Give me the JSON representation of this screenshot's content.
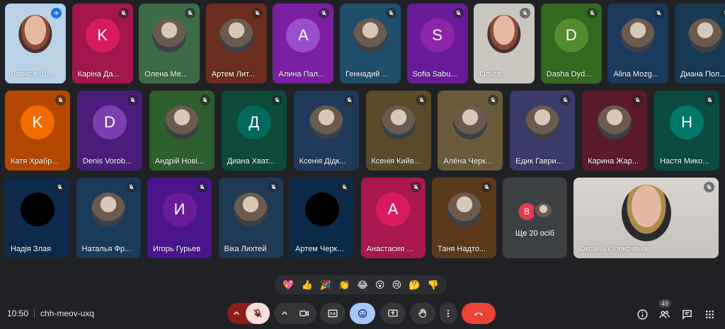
{
  "participants_row1": [
    {
      "name": "Лариса Ш...",
      "bg": "#b9d2e6",
      "speaking": true,
      "video": true,
      "mic": "active"
    },
    {
      "name": "Каріна Да...",
      "bg": "#a3164d",
      "initial": "K",
      "avatar": "#d81b60",
      "mic": "muted"
    },
    {
      "name": "Олена Ме...",
      "bg": "#3d6b45",
      "photo": true,
      "mic": "muted"
    },
    {
      "name": "Артем Лит...",
      "bg": "#6b2d1f",
      "photo": true,
      "mic": "muted"
    },
    {
      "name": "Алина Пал...",
      "bg": "#7b1fa2",
      "initial": "A",
      "avatar": "#9c4dcc",
      "mic": "muted"
    },
    {
      "name": "Геннадий ...",
      "bg": "#1f4e6b",
      "photo": true,
      "mic": "muted"
    },
    {
      "name": "Sofia Sabu...",
      "bg": "#6a1b9a",
      "initial": "S",
      "avatar": "#8e24aa",
      "mic": "muted"
    },
    {
      "name": "Ольга ...",
      "bg": "#c9c6c0",
      "video": true,
      "mic": "muted"
    },
    {
      "name": "Dasha Dyd...",
      "bg": "#33691e",
      "initial": "D",
      "avatar": "#558b2f",
      "mic": "muted"
    },
    {
      "name": "Alina Mozg...",
      "bg": "#1a3a5c",
      "photo": true,
      "mic": "muted"
    },
    {
      "name": "Диана Пол...",
      "bg": "#173a52",
      "photo": true,
      "mic": "muted"
    }
  ],
  "participants_row2": [
    {
      "name": "Катя Храбр...",
      "bg": "#b34700",
      "initial": "K",
      "avatar": "#ef6c00",
      "mic": "muted"
    },
    {
      "name": "Denis Vorob...",
      "bg": "#4a1d7a",
      "initial": "D",
      "avatar": "#7b3fb0",
      "mic": "muted"
    },
    {
      "name": "Андрій Нові...",
      "bg": "#2e5e2e",
      "photo": true,
      "mic": "muted"
    },
    {
      "name": "Диана Хват...",
      "bg": "#0d4a3a",
      "initial": "Д",
      "avatar": "#00695c",
      "mic": "muted"
    },
    {
      "name": "Ксенія Дідк...",
      "bg": "#1f3a5a",
      "photo": true,
      "mic": "muted"
    },
    {
      "name": "Ксенія Кийв...",
      "bg": "#5a4a2a",
      "photo": true,
      "mic": "muted"
    },
    {
      "name": "Алёна Черк...",
      "bg": "#6b5a3a",
      "photo": true,
      "mic": "muted"
    },
    {
      "name": "Едик Гаври...",
      "bg": "#3a3a6b",
      "photo": true,
      "mic": "muted"
    },
    {
      "name": "Карина Жар...",
      "bg": "#5a1a2a",
      "photo": true,
      "mic": "muted"
    },
    {
      "name": "Настя Мико...",
      "bg": "#0a4a40",
      "initial": "Н",
      "avatar": "#00796b",
      "mic": "muted"
    }
  ],
  "participants_row3": [
    {
      "name": "Надія Злая",
      "bg": "#0d2a4a",
      "photo": true,
      "dark": true,
      "mic": "muted"
    },
    {
      "name": "Наталья Фр...",
      "bg": "#1a3a5a",
      "photo": true,
      "mic": "muted"
    },
    {
      "name": "Игорь Гурьев",
      "bg": "#4a148c",
      "initial": "И",
      "avatar": "#6a1b9a",
      "mic": "muted"
    },
    {
      "name": "Віка Лихтей",
      "bg": "#1f3a55",
      "photo": true,
      "mic": "muted"
    },
    {
      "name": "Артем Черк...",
      "bg": "#0a2a48",
      "photo": true,
      "dark": true,
      "mic": "muted"
    },
    {
      "name": "Анастасия ...",
      "bg": "#a8174f",
      "initial": "A",
      "avatar": "#d81b60",
      "mic": "muted"
    },
    {
      "name": "Таня Надто...",
      "bg": "#5a3a1a",
      "photo": true,
      "mic": "muted"
    }
  ],
  "more": {
    "label": "Ще 20 осіб",
    "badge_initial": "В",
    "badge_color": "#e53950"
  },
  "spotlight": {
    "name": "Оксана Олексіївна",
    "bg": "#c5c2bd",
    "mic": "muted"
  },
  "reactions": [
    "💖",
    "👍",
    "🎉",
    "👏",
    "😂",
    "😮",
    "😢",
    "🤔",
    "👎"
  ],
  "meeting": {
    "time": "10:50",
    "code": "chh-meov-uxq"
  },
  "people_count": "49",
  "colors": {
    "end_call": "#ea4335",
    "mic_off": "#f9dedc",
    "accent_on": "#a8c7fa",
    "panel": "#333537"
  }
}
